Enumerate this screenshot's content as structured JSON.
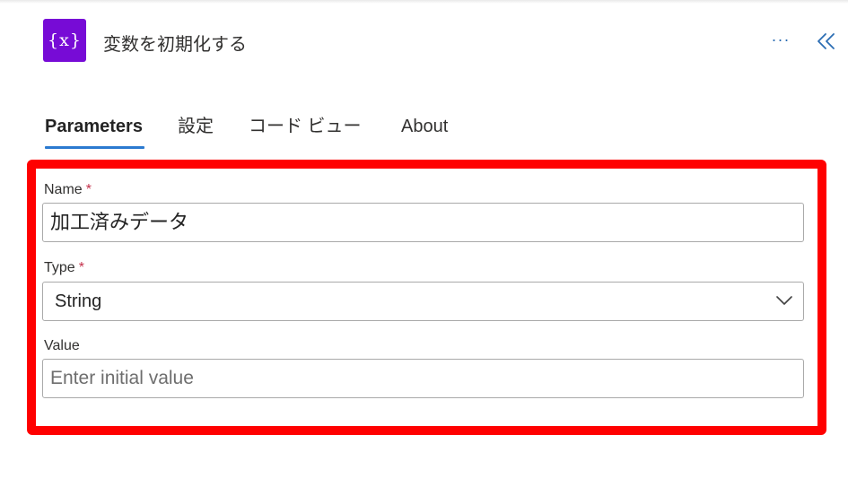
{
  "header": {
    "icon_label": "{x}",
    "title": "変数を初期化する",
    "more_label": "···",
    "icon_color": "#770bd6"
  },
  "tabs": [
    {
      "label": "Parameters",
      "active": true
    },
    {
      "label": "設定",
      "active": false
    },
    {
      "label": "コード ビュー",
      "active": false
    },
    {
      "label": "About",
      "active": false
    }
  ],
  "form": {
    "name": {
      "label": "Name",
      "required_mark": "*",
      "value": "加工済みデータ"
    },
    "type": {
      "label": "Type",
      "required_mark": "*",
      "selected": "String"
    },
    "value": {
      "label": "Value",
      "placeholder": "Enter initial value",
      "value": ""
    }
  },
  "colors": {
    "accent": "#2b7ad0",
    "highlight": "#ff0000",
    "required": "#c4314b"
  },
  "icons": [
    "variable-icon",
    "more-icon",
    "collapse-icon",
    "chevron-down-icon"
  ]
}
